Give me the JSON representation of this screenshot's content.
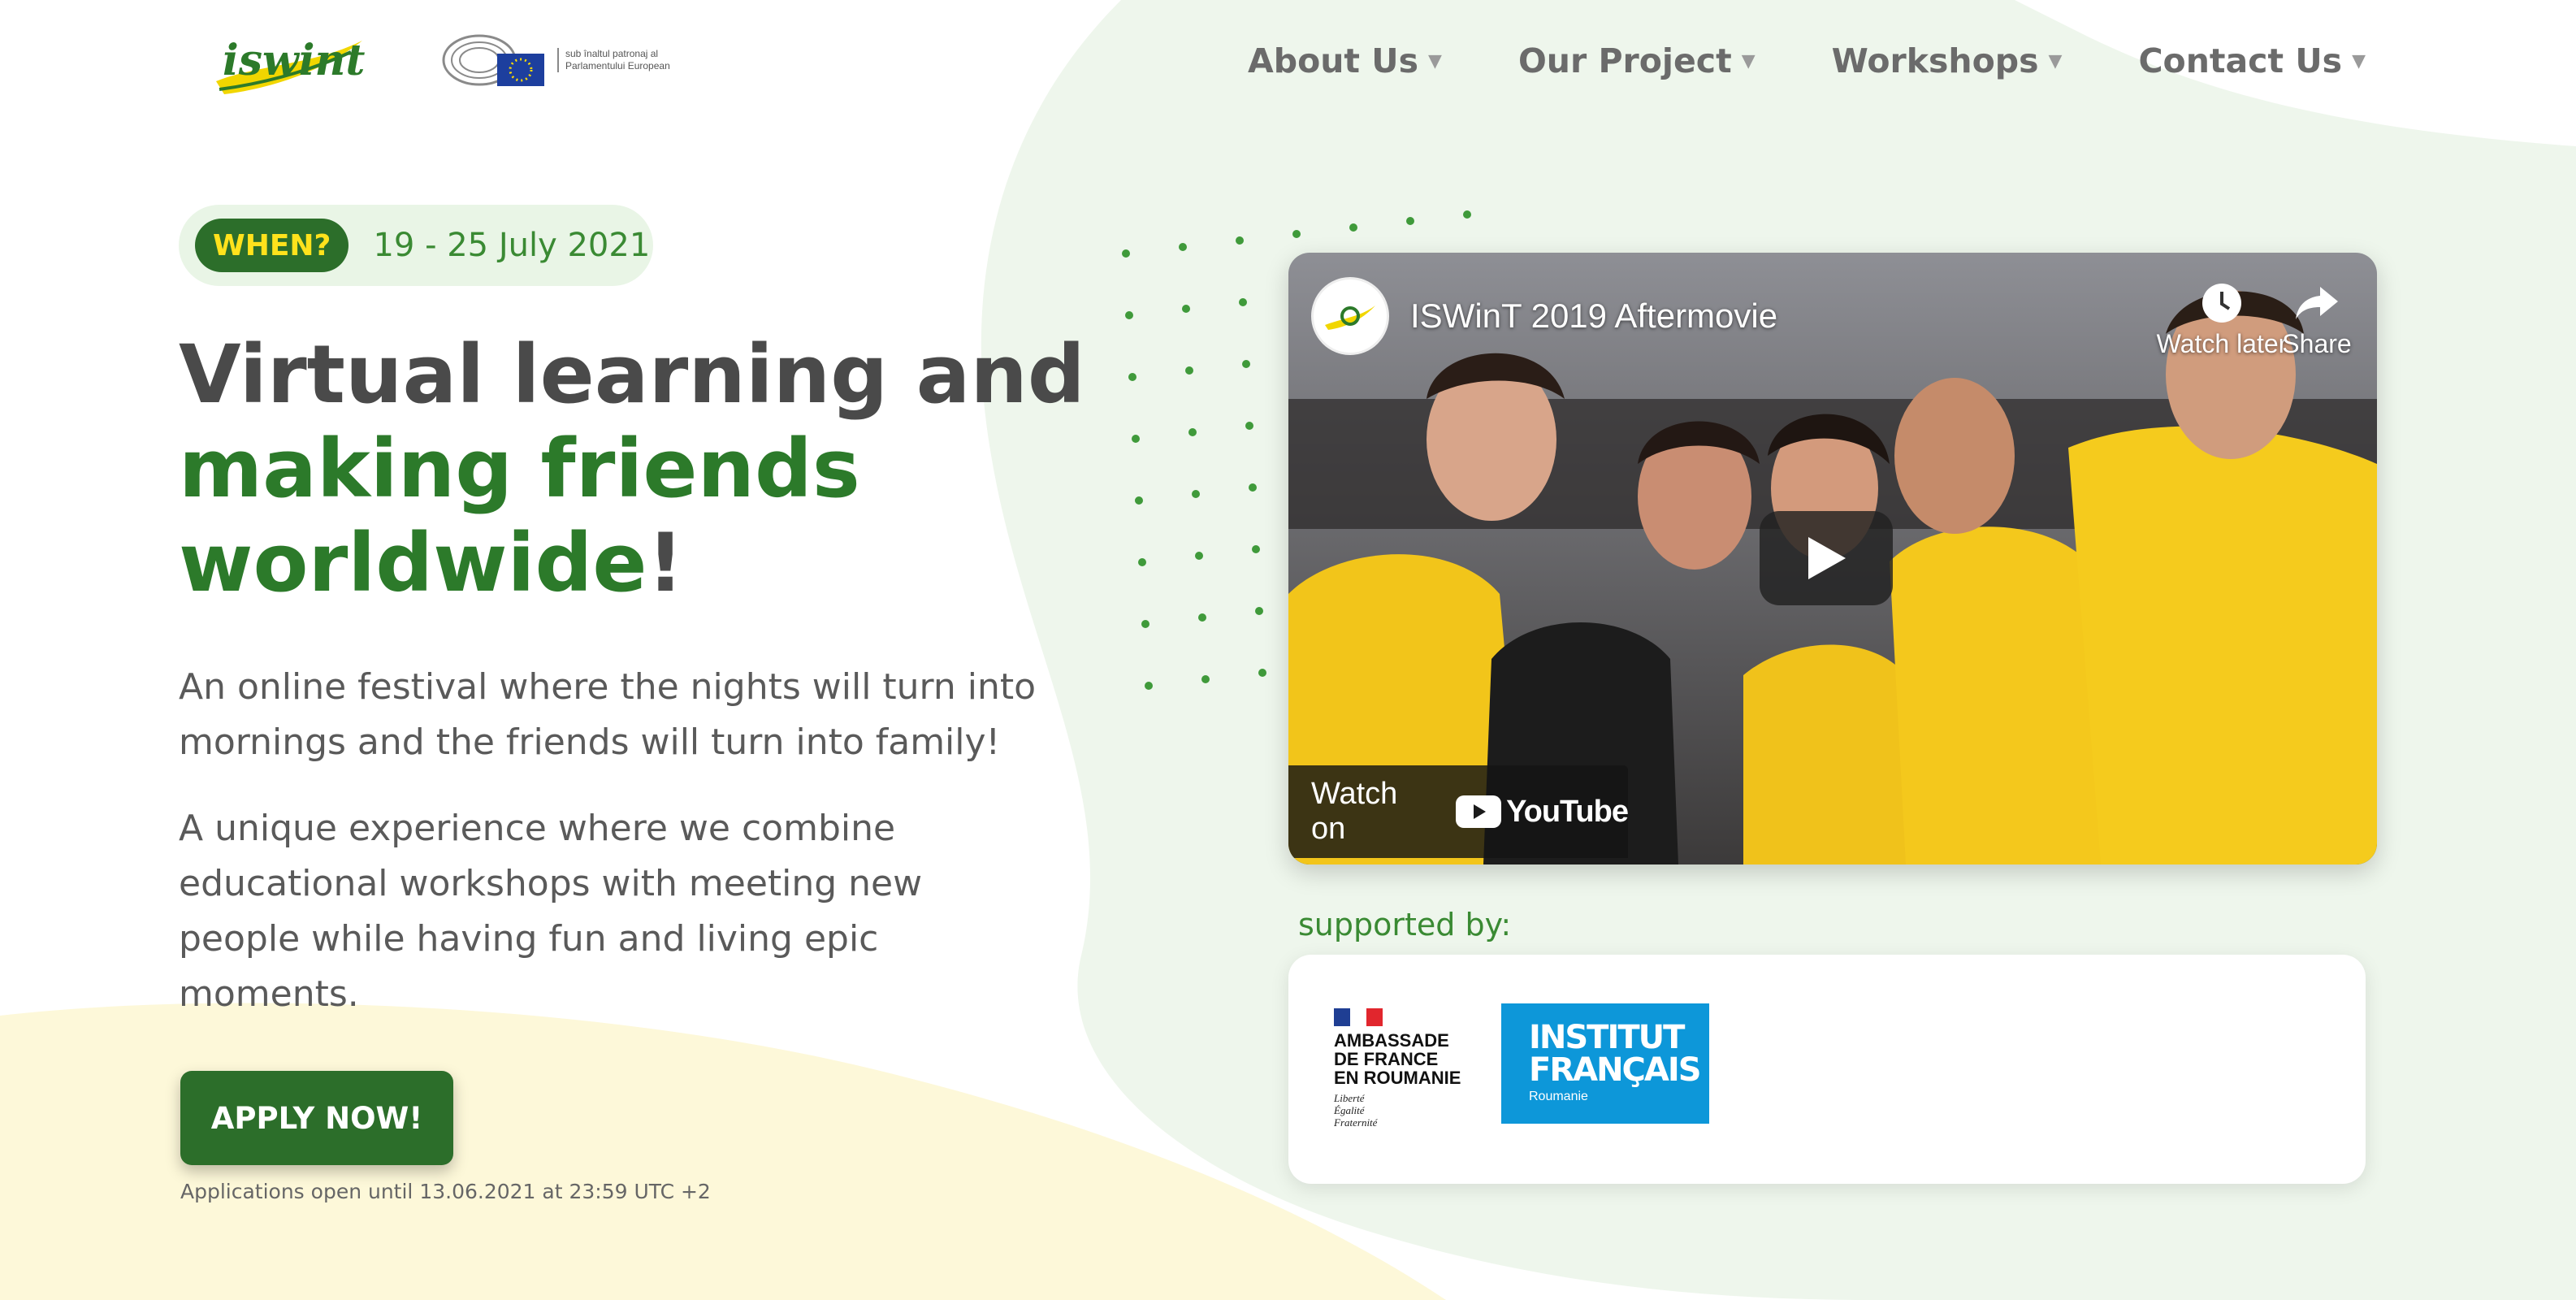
{
  "header": {
    "logo_text": "iswint",
    "ep_caption": "sub înaltul patronaj al Parlamentului European",
    "nav": [
      {
        "label": "About Us"
      },
      {
        "label": "Our Project"
      },
      {
        "label": "Workshops"
      },
      {
        "label": "Contact Us"
      }
    ]
  },
  "hero": {
    "when_label": "WHEN?",
    "when_date": "19 - 25 July 2021",
    "headline_line1": "Virtual learning and",
    "headline_line2": "making friends",
    "headline_line3": "worldwide",
    "headline_exclaim": "!",
    "paragraph1": "An online festival where the nights will turn into mornings and the friends will turn into family!",
    "paragraph2": "A unique experience where we combine educational workshops with meeting new people while having fun and living epic moments.",
    "apply_label": "APPLY NOW!",
    "apply_note": "Applications open until 13.06.2021 at 23:59 UTC +2"
  },
  "video": {
    "title": "ISWinT 2019 Aftermovie",
    "watch_later": "Watch later",
    "share": "Share",
    "watch_on": "Watch on",
    "youtube": "YouTube"
  },
  "support": {
    "label": "supported by:",
    "ambassade": [
      "AMBASSADE",
      "DE FRANCE",
      "EN ROUMANIE"
    ],
    "ambassade_motto": [
      "Liberté",
      "Égalité",
      "Fraternité"
    ],
    "institut": [
      "INSTITUT",
      "FRANÇAIS"
    ],
    "institut_sub": "Roumanie"
  },
  "colors": {
    "brand_green": "#2c6e2a",
    "accent_yellow": "#ffe21c",
    "nav_text": "#6b6b6b"
  }
}
